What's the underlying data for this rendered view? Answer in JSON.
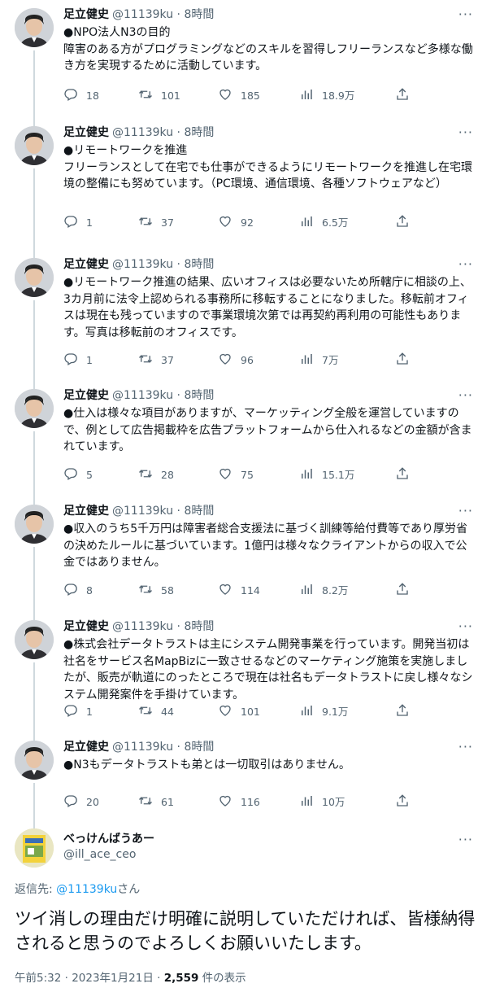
{
  "tweets": [
    {
      "name": "足立健史",
      "handle": "@11139ku",
      "time": "8時間",
      "text": "●NPO法人N3の目的\n障害のある方がプログラミングなどのスキルを習得しフリーランスなど多様な働き方を実現するために活動しています。",
      "replies": "18",
      "retweets": "101",
      "likes": "185",
      "views": "18.9万"
    },
    {
      "name": "足立健史",
      "handle": "@11139ku",
      "time": "8時間",
      "text": "●リモートワークを推進\nフリーランスとして在宅でも仕事ができるようにリモートワークを推進し在宅環境の整備にも努めています。（PC環境、通信環境、各種ソフトウェアなど）",
      "replies": "1",
      "retweets": "37",
      "likes": "92",
      "views": "6.5万"
    },
    {
      "name": "足立健史",
      "handle": "@11139ku",
      "time": "8時間",
      "text": "●リモートワーク推進の結果、広いオフィスは必要ないため所轄庁に相談の上、3カ月前に法令上認められる事務所に移転することになりました。移転前オフィスは現在も残っていますので事業環境次第では再契約再利用の可能性もあります。写真は移転前のオフィスです。",
      "replies": "1",
      "retweets": "37",
      "likes": "96",
      "views": "7万"
    },
    {
      "name": "足立健史",
      "handle": "@11139ku",
      "time": "8時間",
      "text": "●仕入は様々な項目がありますが、マーケッティング全般を運営していますので、例として広告掲載枠を広告プラットフォームから仕入れるなどの金額が含まれています。",
      "replies": "5",
      "retweets": "28",
      "likes": "75",
      "views": "15.1万"
    },
    {
      "name": "足立健史",
      "handle": "@11139ku",
      "time": "8時間",
      "text": "●収入のうち5千万円は障害者総合支援法に基づく訓練等給付費等であり厚労省の決めたルールに基づいています。1億円は様々なクライアントからの収入で公金ではありません。",
      "replies": "8",
      "retweets": "58",
      "likes": "114",
      "views": "8.2万"
    },
    {
      "name": "足立健史",
      "handle": "@11139ku",
      "time": "8時間",
      "text": "●株式会社データトラストは主にシステム開発事業を行っています。開発当初は社名をサービス名MapBizに一致させるなどのマーケティング施策を実施しましたが、販売が軌道にのったところで現在は社名もデータトラストに戻し様々なシステム開発案件を手掛けています。",
      "replies": "1",
      "retweets": "44",
      "likes": "101",
      "views": "9.1万"
    },
    {
      "name": "足立健史",
      "handle": "@11139ku",
      "time": "8時間",
      "text": "●N3もデータトラストも弟とは一切取引はありません。",
      "replies": "20",
      "retweets": "61",
      "likes": "116",
      "views": "10万"
    }
  ],
  "main": {
    "name": "べっけんばうあー",
    "handle": "@ill_ace_ceo",
    "reply_prefix": "返信先: ",
    "reply_handle": "@11139ku",
    "reply_suffix": "さん",
    "text": "ツイ消しの理由だけ明確に説明していただければ、皆様納得されると思うのでよろしくお願いいたします。",
    "timestamp": "午前5:32 · 2023年1月21日 · ",
    "views_count": "2,559",
    "views_label": " 件の表示"
  },
  "more_glyph": "···",
  "colors": {
    "text": "#0f1419",
    "secondary": "#536471",
    "link": "#1d9bf0",
    "line": "#cfd9de"
  }
}
